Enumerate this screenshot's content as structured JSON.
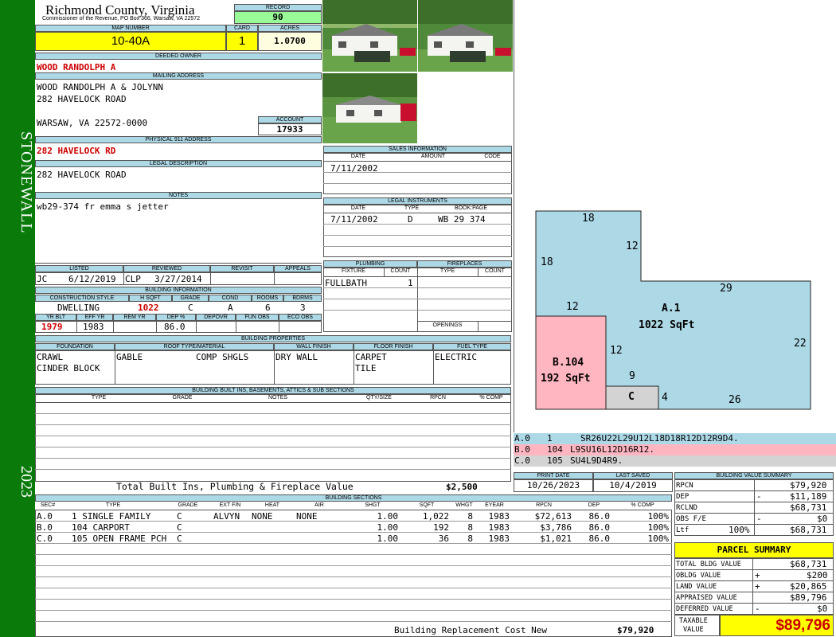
{
  "side": {
    "district": "STONEWALL",
    "year": "2023"
  },
  "header": {
    "county": "Richmond County, Virginia",
    "sub": "Commissioner of the Revenue, PO Box 366, Warsaw, VA 22572",
    "record_label": "RECORD",
    "record": "90",
    "map_label": "MAP NUMBER",
    "map": "10-40A",
    "card_label": "CARD",
    "card": "1",
    "acres_label": "ACRES",
    "acres": "1.0700"
  },
  "owner": {
    "label": "DEEDED OWNER",
    "name": "WOOD RANDOLPH A"
  },
  "mailing": {
    "label": "MAILING ADDRESS",
    "line1": "WOOD RANDOLPH A & JOLYNN",
    "line2": "282 HAVELOCK ROAD",
    "line3": "WARSAW, VA 22572-0000",
    "account_label": "ACCOUNT",
    "account": "17933"
  },
  "physical": {
    "label": "PHYSICAL 911 ADDRESS",
    "value": "282 HAVELOCK RD"
  },
  "legal": {
    "label": "LEGAL DESCRIPTION",
    "value": "282 HAVELOCK ROAD"
  },
  "notes": {
    "label": "NOTES",
    "value": "wb29-374 fr emma s jetter"
  },
  "sales": {
    "label": "SALES INFORMATION",
    "h_date": "DATE",
    "h_amount": "AMOUNT",
    "h_code": "CODE",
    "date": "7/11/2002"
  },
  "instruments": {
    "label": "LEGAL INSTRUMENTS",
    "h_date": "DATE",
    "h_type": "TYPE",
    "h_book": "BOOK:PAGE",
    "date": "7/11/2002",
    "type": "D",
    "book": "WB 29 374"
  },
  "listed": {
    "h_listed": "LISTED",
    "h_reviewed": "REVIEWED",
    "h_revisit": "REVISIT",
    "h_appeals": "APPEALS",
    "listed_by": "JC",
    "listed_date": "6/12/2019",
    "reviewed_by": "CLP",
    "reviewed_date": "3/27/2014"
  },
  "building": {
    "label": "BUILDING INFORMATION",
    "h_style": "CONSTRUCTION STYLE",
    "h_hsqft": "H SQFT",
    "h_grade": "GRADE",
    "h_cond": "COND",
    "h_rooms": "ROOMS",
    "h_bdrms": "BDRMS",
    "style": "DWELLING",
    "hsqft": "1022",
    "grade": "C",
    "cond": "A",
    "rooms": "6",
    "bdrms": "3",
    "h_yrblt": "YR BLT",
    "h_effyr": "EFF YR",
    "h_remyr": "REM YR",
    "h_dep": "DEP %",
    "h_depovr": "DEPOVR",
    "h_funobs": "FUN OBS",
    "h_ecoobs": "ECO OBS",
    "yrblt": "1979",
    "effyr": "1983",
    "dep": "86.0"
  },
  "plumbing": {
    "label": "PLUMBING",
    "h_fixture": "FIXTURE",
    "h_count": "COUNT",
    "fixture": "FULLBATH",
    "count": "1"
  },
  "fireplaces": {
    "label": "FIREPLACES",
    "h_type": "TYPE",
    "h_count": "COUNT",
    "openings": "OPENINGS"
  },
  "props": {
    "label": "BUILDING PROPERTIES",
    "h_foundation": "FOUNDATION",
    "h_roof": "ROOF TYPE/MATERIAL",
    "h_wall": "WALL FINISH",
    "h_floor": "FLOOR FINISH",
    "h_fuel": "FUEL TYPE",
    "found1": "CRAWL",
    "found2": "CINDER BLOCK",
    "roof1": "GABLE",
    "roof2": "COMP SHGLS",
    "wall": "DRY WALL",
    "floor1": "CARPET",
    "floor2": "TILE",
    "fuel": "ELECTRIC"
  },
  "builtins": {
    "label": "BUILDING BUILT INS, BASEMENTS, ATTICS & SUB SECTIONS",
    "h_type": "TYPE",
    "h_grade": "GRADE",
    "h_notes": "NOTES",
    "h_qty": "QTY/SIZE",
    "h_rpcn": "RPCN",
    "h_comp": "% COMP",
    "total_label": "Total Built Ins, Plumbing & Fireplace Value",
    "total": "$2,500"
  },
  "dates": {
    "h_print": "PRINT DATE",
    "h_saved": "LAST SAVED",
    "print": "10/26/2023",
    "saved": "10/4/2019"
  },
  "sketch": {
    "labels": {
      "top": "18",
      "right12": "12",
      "left18": "18",
      "mid29": "29",
      "a12": "12",
      "aname": "A.1",
      "asqft": "1022 SqFt",
      "r22": "22",
      "b12": "12",
      "bname": "B.104",
      "bsqft": "192 SqFt",
      "c9": "9",
      "cname": "C",
      "c4": "4",
      "b26": "26"
    },
    "codes": [
      {
        "code": "A.0",
        "num": "1",
        "vec": "SR26U22L29U12L18D18R12D12R9D4.",
        "color": "#add8e6"
      },
      {
        "code": "B.0",
        "num": "104",
        "vec": "L9SU16L12D16R12.",
        "color": "#ffb6c1"
      },
      {
        "code": "C.0",
        "num": "105",
        "vec": "SU4L9D4R9.",
        "color": "#d3d3d3"
      }
    ]
  },
  "sections": {
    "label": "BUILDING SECTIONS",
    "h": [
      "SEC#",
      "TYPE",
      "GRADE",
      "EXT FIN",
      "HEAT",
      "AIR",
      "SHGT",
      "SQFT",
      "WHGT",
      "EYEAR",
      "RPCN",
      "DEP",
      "% COMP"
    ],
    "rows": [
      [
        "A.0",
        "1 SINGLE FAMILY",
        "C",
        "ALVYN",
        "NONE",
        "NONE",
        "1.00",
        "1,022",
        "8",
        "1983",
        "$72,613",
        "86.0",
        "100%"
      ],
      [
        "B.0",
        "104 CARPORT",
        "C",
        "",
        "",
        "",
        "1.00",
        "192",
        "8",
        "1983",
        "$3,786",
        "86.0",
        "100%"
      ],
      [
        "C.0",
        "105 OPEN FRAME PCH",
        "C",
        "",
        "",
        "",
        "1.00",
        "36",
        "8",
        "1983",
        "$1,021",
        "86.0",
        "100%"
      ]
    ],
    "total_label": "Building Replacement Cost New",
    "total": "$79,920"
  },
  "bvs": {
    "label": "BUILDING VALUE SUMMARY",
    "rpcn_l": "RPCN",
    "rpcn": "$79,920",
    "dep_l": "DEP",
    "dep_sign": "-",
    "dep": "$11,189",
    "rclnd_l": "RCLND",
    "rclnd": "$68,731",
    "obs_l": "OBS F/E",
    "obs_sign": "-",
    "obs": "$0",
    "ltf_l": "Ltf",
    "ltf_pct": "100%",
    "ltf": "$68,731"
  },
  "parcel": {
    "label": "PARCEL SUMMARY",
    "tbv_l": "TOTAL BLDG VALUE",
    "tbv": "$68,731",
    "obldg_l": "OBLDG VALUE",
    "obldg_sign": "+",
    "obldg": "$200",
    "land_l": "LAND VALUE",
    "land_sign": "+",
    "land": "$20,865",
    "appr_l": "APPRAISED VALUE",
    "appr": "$89,796",
    "def_l": "DEFERRED VALUE",
    "def_sign": "-",
    "def": "$0",
    "tax_l1": "TAXABLE",
    "tax_l2": "VALUE",
    "tax": "$89,796"
  }
}
